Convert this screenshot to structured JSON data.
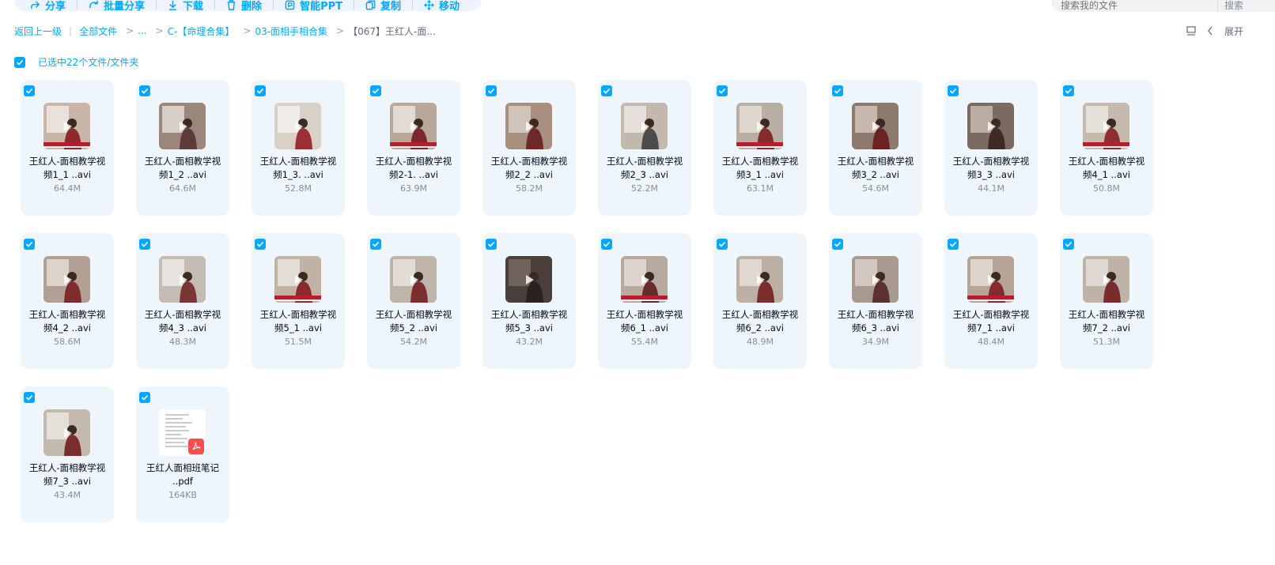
{
  "toolbar": {
    "items": [
      {
        "label": "分享",
        "icon": "share-icon"
      },
      {
        "label": "批量分享",
        "icon": "batch-share-icon"
      },
      {
        "label": "下载",
        "icon": "download-icon"
      },
      {
        "label": "删除",
        "icon": "delete-icon"
      },
      {
        "label": "智能PPT",
        "icon": "ppt-icon"
      },
      {
        "label": "复制",
        "icon": "copy-icon"
      },
      {
        "label": "移动",
        "icon": "move-icon"
      }
    ]
  },
  "search": {
    "placeholder": "搜索我的文件",
    "button": "搜索"
  },
  "breadcrumb": {
    "back": "返回上一级",
    "items": [
      "全部文件",
      "...",
      "C-【命理合集】",
      "03-面相手相合集",
      "【067】王红人-面..."
    ]
  },
  "right_tools": {
    "expand_label": "展开"
  },
  "selection": {
    "label": "已选中22个文件/文件夹"
  },
  "colors": {
    "accent": "#06a7ff",
    "card_bg": "#eef6fc"
  },
  "files": [
    {
      "name_line1": "王红人-面相教学视",
      "name_line2": "频1_1 ..avi",
      "size": "64.4M",
      "type": "video"
    },
    {
      "name_line1": "王红人-面相教学视",
      "name_line2": "频1_2 ..avi",
      "size": "64.6M",
      "type": "video"
    },
    {
      "name_line1": "王红人-面相教学视",
      "name_line2": "频1_3. ..avi",
      "size": "52.8M",
      "type": "video"
    },
    {
      "name_line1": "王红人-面相教学视",
      "name_line2": "频2-1. ..avi",
      "size": "63.9M",
      "type": "video"
    },
    {
      "name_line1": "王红人-面相教学视",
      "name_line2": "频2_2 ..avi",
      "size": "58.2M",
      "type": "video"
    },
    {
      "name_line1": "王红人-面相教学视",
      "name_line2": "频2_3 ..avi",
      "size": "52.2M",
      "type": "video"
    },
    {
      "name_line1": "王红人-面相教学视",
      "name_line2": "频3_1 ..avi",
      "size": "63.1M",
      "type": "video"
    },
    {
      "name_line1": "王红人-面相教学视",
      "name_line2": "频3_2 ..avi",
      "size": "54.6M",
      "type": "video"
    },
    {
      "name_line1": "王红人-面相教学视",
      "name_line2": "频3_3 ..avi",
      "size": "44.1M",
      "type": "video"
    },
    {
      "name_line1": "王红人-面相教学视",
      "name_line2": "频4_1 ..avi",
      "size": "50.8M",
      "type": "video"
    },
    {
      "name_line1": "王红人-面相教学视",
      "name_line2": "频4_2 ..avi",
      "size": "58.6M",
      "type": "video"
    },
    {
      "name_line1": "王红人-面相教学视",
      "name_line2": "频4_3 ..avi",
      "size": "48.3M",
      "type": "video"
    },
    {
      "name_line1": "王红人-面相教学视",
      "name_line2": "频5_1 ..avi",
      "size": "51.5M",
      "type": "video"
    },
    {
      "name_line1": "王红人-面相教学视",
      "name_line2": "频5_2 ..avi",
      "size": "54.2M",
      "type": "video"
    },
    {
      "name_line1": "王红人-面相教学视",
      "name_line2": "频5_3 ..avi",
      "size": "43.2M",
      "type": "video"
    },
    {
      "name_line1": "王红人-面相教学视",
      "name_line2": "频6_1 ..avi",
      "size": "55.4M",
      "type": "video"
    },
    {
      "name_line1": "王红人-面相教学视",
      "name_line2": "频6_2 ..avi",
      "size": "48.9M",
      "type": "video"
    },
    {
      "name_line1": "王红人-面相教学视",
      "name_line2": "频6_3 ..avi",
      "size": "34.9M",
      "type": "video"
    },
    {
      "name_line1": "王红人-面相教学视",
      "name_line2": "频7_1 ..avi",
      "size": "48.4M",
      "type": "video"
    },
    {
      "name_line1": "王红人-面相教学视",
      "name_line2": "频7_2 ..avi",
      "size": "51.3M",
      "type": "video"
    },
    {
      "name_line1": "王红人-面相教学视",
      "name_line2": "频7_3 ..avi",
      "size": "43.4M",
      "type": "video"
    },
    {
      "name_line1": "王红人面相班笔记",
      "name_line2": "..pdf",
      "size": "164KB",
      "type": "pdf"
    }
  ]
}
